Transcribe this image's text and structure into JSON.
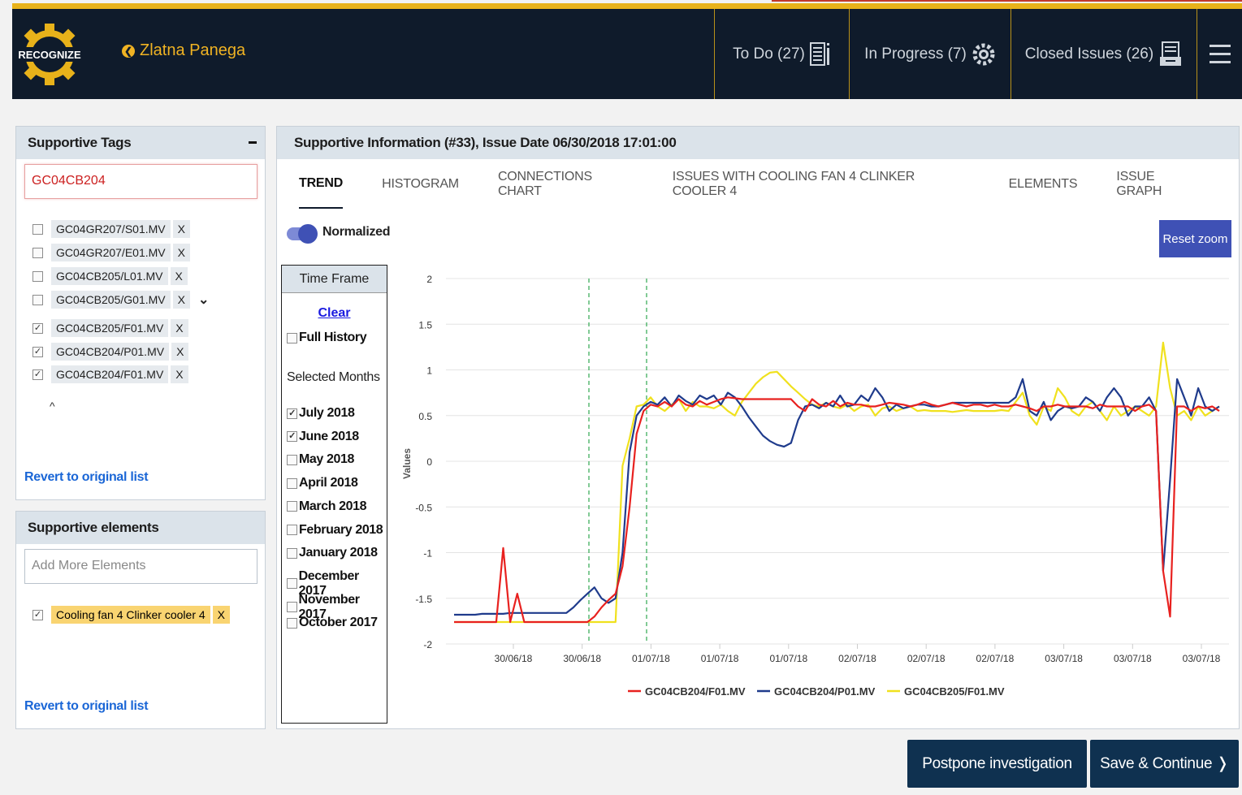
{
  "header": {
    "logo_text": "RECOGNIZE",
    "site_name": "Zlatna Panega",
    "nav": [
      {
        "label": "To Do (27)",
        "icon": "document-list-icon"
      },
      {
        "label": "In Progress (7)",
        "icon": "gear-icon"
      },
      {
        "label": "Closed Issues (26)",
        "icon": "archive-icon"
      }
    ]
  },
  "tags_panel": {
    "title": "Supportive Tags",
    "input_value": "GC04CB204",
    "tags": [
      {
        "label": "GC04GR207/S01.MV",
        "checked": false
      },
      {
        "label": "GC04GR207/E01.MV",
        "checked": false
      },
      {
        "label": "GC04CB205/L01.MV",
        "checked": false
      },
      {
        "label": "GC04CB205/G01.MV",
        "checked": false
      },
      {
        "label": "GC04CB205/F01.MV",
        "checked": true
      },
      {
        "label": "GC04CB204/P01.MV",
        "checked": true
      },
      {
        "label": "GC04CB204/F01.MV",
        "checked": true
      }
    ],
    "remove_label": "X",
    "revert_label": "Revert to original list"
  },
  "elements_panel": {
    "title": "Supportive elements",
    "placeholder": "Add More Elements",
    "element": "Cooling fan 4 Clinker cooler 4",
    "remove_label": "X",
    "revert_label": "Revert to original list"
  },
  "main": {
    "title": "Supportive Information (#33), Issue Date 06/30/2018 17:01:00",
    "tabs": [
      "TREND",
      "HISTOGRAM",
      "CONNECTIONS CHART",
      "ISSUES WITH COOLING FAN 4 CLINKER COOLER 4",
      "ELEMENTS",
      "ISSUE GRAPH"
    ],
    "toggle_label": "Normalized",
    "reset_zoom": "Reset zoom"
  },
  "timeframe": {
    "title": "Time Frame",
    "clear": "Clear",
    "full_history": "Full History",
    "selected_months_label": "Selected Months",
    "months": [
      {
        "label": "July 2018",
        "checked": true
      },
      {
        "label": "June 2018",
        "checked": true
      },
      {
        "label": "May 2018",
        "checked": false
      },
      {
        "label": "April 2018",
        "checked": false
      },
      {
        "label": "March 2018",
        "checked": false
      },
      {
        "label": "February 2018",
        "checked": false
      },
      {
        "label": "January 2018",
        "checked": false
      },
      {
        "label": "December 2017",
        "checked": false
      },
      {
        "label": "November 2017",
        "checked": false
      },
      {
        "label": "October 2017",
        "checked": false
      }
    ]
  },
  "chart_data": {
    "type": "line",
    "ylabel": "Values",
    "ylim": [
      -2,
      2
    ],
    "y_ticks": [
      "2",
      "1.5",
      "1",
      "0.5",
      "0",
      "-0.5",
      "-1",
      "-1.5",
      "-2"
    ],
    "x_ticks": [
      "30/06/18",
      "30/06/18",
      "01/07/18",
      "01/07/18",
      "01/07/18",
      "02/07/18",
      "02/07/18",
      "02/07/18",
      "03/07/18",
      "03/07/18",
      "03/07/18"
    ],
    "grid": true,
    "legend_position": "bottom",
    "series": [
      {
        "name": "GC04CB204/F01.MV",
        "color": "#e8211f",
        "values": [
          -1.76,
          -1.76,
          -1.76,
          -1.76,
          -1.76,
          -1.76,
          -1.76,
          -0.95,
          -1.76,
          -1.45,
          -1.76,
          -1.76,
          -1.76,
          -1.76,
          -1.76,
          -1.76,
          -1.76,
          -1.76,
          -1.76,
          -1.76,
          -1.7,
          -1.6,
          -1.52,
          -1.45,
          -1.15,
          -0.5,
          0.3,
          0.55,
          0.62,
          0.6,
          0.65,
          0.6,
          0.68,
          0.62,
          0.6,
          0.66,
          0.62,
          0.65,
          0.68,
          0.7,
          0.69,
          0.68,
          0.68,
          0.68,
          0.68,
          0.68,
          0.68,
          0.68,
          0.68,
          0.6,
          0.55,
          0.68,
          0.62,
          0.6,
          0.66,
          0.6,
          0.64,
          0.62,
          0.62,
          0.6,
          0.6,
          0.62,
          0.64,
          0.63,
          0.62,
          0.6,
          0.62,
          0.65,
          0.62,
          0.6,
          0.62,
          0.64,
          0.62,
          0.6,
          0.62,
          0.62,
          0.6,
          0.62,
          0.6,
          0.6,
          0.62,
          0.6,
          0.58,
          0.55,
          0.6,
          0.6,
          0.62,
          0.6,
          0.6,
          0.6,
          0.6,
          0.58,
          0.62,
          0.6,
          0.6,
          0.6,
          0.6,
          0.55,
          0.6,
          0.62,
          0.55,
          -1.2,
          -1.7,
          0.6,
          0.6,
          0.55,
          0.6,
          0.58,
          0.6,
          0.55
        ]
      },
      {
        "name": "GC04CB204/P01.MV",
        "color": "#1f3b8c",
        "values": [
          -1.68,
          -1.68,
          -1.68,
          -1.68,
          -1.67,
          -1.67,
          -1.67,
          -1.67,
          -1.66,
          -1.66,
          -1.66,
          -1.66,
          -1.66,
          -1.66,
          -1.66,
          -1.66,
          -1.66,
          -1.6,
          -1.52,
          -1.45,
          -1.38,
          -1.5,
          -1.55,
          -1.5,
          -1.0,
          0.1,
          0.5,
          0.6,
          0.65,
          0.62,
          0.7,
          0.6,
          0.72,
          0.66,
          0.62,
          0.72,
          0.68,
          0.72,
          0.62,
          0.75,
          0.7,
          0.6,
          0.48,
          0.38,
          0.28,
          0.22,
          0.18,
          0.16,
          0.2,
          0.45,
          0.6,
          0.62,
          0.58,
          0.64,
          0.6,
          0.72,
          0.6,
          0.62,
          0.72,
          0.66,
          0.8,
          0.7,
          0.55,
          0.62,
          0.58,
          0.6,
          0.62,
          0.62,
          0.6,
          0.6,
          0.62,
          0.64,
          0.64,
          0.64,
          0.64,
          0.64,
          0.64,
          0.64,
          0.64,
          0.64,
          0.7,
          0.9,
          0.55,
          0.5,
          0.65,
          0.45,
          0.55,
          0.6,
          0.58,
          0.6,
          0.7,
          0.65,
          0.55,
          0.7,
          0.8,
          0.7,
          0.5,
          0.6,
          0.6,
          0.7,
          0.55,
          -1.2,
          -0.2,
          0.9,
          0.7,
          0.5,
          0.8,
          0.6,
          0.55,
          0.6
        ]
      },
      {
        "name": "GC04CB205/F01.MV",
        "color": "#f0e11e",
        "values": [
          -1.76,
          -1.76,
          -1.76,
          -1.76,
          -1.76,
          -1.76,
          -1.76,
          -1.76,
          -1.76,
          -1.76,
          -1.76,
          -1.76,
          -1.76,
          -1.76,
          -1.76,
          -1.76,
          -1.76,
          -1.76,
          -1.76,
          -1.76,
          -1.76,
          -1.76,
          -1.76,
          -1.76,
          -0.05,
          0.25,
          0.6,
          0.62,
          0.7,
          0.6,
          0.55,
          0.62,
          0.68,
          0.55,
          0.65,
          0.6,
          0.6,
          0.58,
          0.62,
          0.55,
          0.5,
          0.65,
          0.75,
          0.85,
          0.92,
          0.97,
          0.98,
          0.9,
          0.82,
          0.75,
          0.68,
          0.62,
          0.6,
          0.64,
          0.6,
          0.58,
          0.62,
          0.55,
          0.6,
          0.62,
          0.5,
          0.58,
          0.6,
          0.55,
          0.58,
          0.6,
          0.55,
          0.56,
          0.55,
          0.55,
          0.55,
          0.54,
          0.55,
          0.56,
          0.55,
          0.55,
          0.55,
          0.55,
          0.56,
          0.55,
          0.65,
          0.75,
          0.5,
          0.4,
          0.6,
          0.55,
          0.8,
          0.7,
          0.55,
          0.5,
          0.6,
          0.65,
          0.55,
          0.45,
          0.6,
          0.5,
          0.55,
          0.6,
          0.55,
          0.5,
          0.6,
          1.3,
          0.8,
          0.5,
          0.55,
          0.45,
          0.6,
          0.5,
          0.55,
          0.6
        ]
      }
    ]
  },
  "actions": {
    "postpone": "Postpone investigation",
    "save": "Save & Continue ❭"
  }
}
